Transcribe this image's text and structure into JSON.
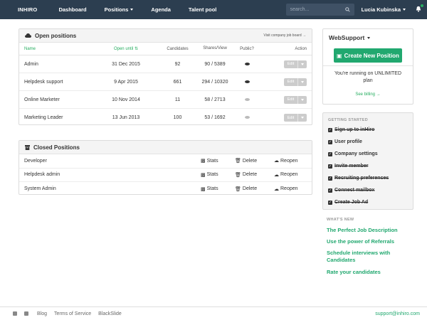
{
  "nav": {
    "brand": "INHIRO",
    "items": [
      "Dashboard",
      "Positions",
      "Agenda",
      "Talent pool"
    ],
    "search_placeholder": "search...",
    "user": "Lucia Kubinska"
  },
  "open_positions": {
    "title": "Open positions",
    "link": "Visit company job board →",
    "columns": [
      "Name",
      "Open until",
      "Candidates",
      "Shares/View",
      "Public?",
      "Action"
    ],
    "edit_label": "Edit",
    "rows": [
      {
        "name": "Admin",
        "until": "31 Dec 2015",
        "candidates": "92",
        "shares": "90 / 5389"
      },
      {
        "name": "Helpdesk support",
        "until": "9 Apr 2015",
        "candidates": "661",
        "shares": "294 / 10320"
      },
      {
        "name": "Online Marketer",
        "until": "10 Nov 2014",
        "candidates": "11",
        "shares": "58 / 2713"
      },
      {
        "name": "Marketing Leader",
        "until": "13 Jun 2013",
        "candidates": "100",
        "shares": "53 / 1692"
      }
    ]
  },
  "closed_positions": {
    "title": "Closed Positions",
    "stats_label": "Stats",
    "delete_label": "Delete",
    "reopen_label": "Reopen",
    "rows": [
      {
        "name": "Developer"
      },
      {
        "name": "Helpdesk admin"
      },
      {
        "name": "System Admin"
      }
    ]
  },
  "sidebar": {
    "company": "WebSupport",
    "create_label": "Create New Position",
    "plan_text": "You're running on UNLIMITED plan",
    "billing_link": "See billing →",
    "getting_started_title": "GETTING STARTED",
    "getting_started": [
      {
        "label": "Sign up to inHiro",
        "done": true
      },
      {
        "label": "User profile",
        "done": false
      },
      {
        "label": "Company settings",
        "done": false
      },
      {
        "label": "Invite member",
        "done": true
      },
      {
        "label": "Recruiting preferences",
        "done": true
      },
      {
        "label": "Connect mailbox",
        "done": true
      },
      {
        "label": "Create Job Ad",
        "done": true
      }
    ],
    "whats_new_title": "WHAT'S NEW",
    "whats_new": [
      "The Perfect Job Description",
      "Use the power of Referrals",
      "Schedule interviews with Candidates",
      "Rate your candidates"
    ]
  },
  "footer": {
    "links": [
      "Blog",
      "Terms of Service",
      "BlackSlide"
    ],
    "email": "support@inhiro.com"
  },
  "colors": {
    "accent": "#21a86f",
    "nav_bg": "#2c3e50"
  }
}
